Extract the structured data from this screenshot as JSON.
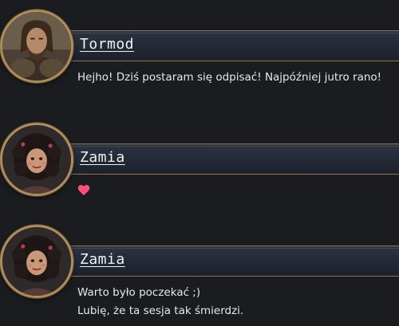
{
  "messages": [
    {
      "author": "Tormod",
      "lines": [
        "Hejho! Dziś postaram się odpisać! Najpóźniej jutro rano!"
      ]
    },
    {
      "author": "Zamia",
      "reaction_icon": "heart-icon",
      "lines": []
    },
    {
      "author": "Zamia",
      "lines": [
        "Warto było poczekać ;)",
        "Lubię, że ta sesja tak śmierdzi."
      ]
    }
  ],
  "colors": {
    "background": "#1b1c20",
    "name_bar": "#262d3a",
    "gold_border": "#b08d5a",
    "heart": "#ff4f7a"
  }
}
